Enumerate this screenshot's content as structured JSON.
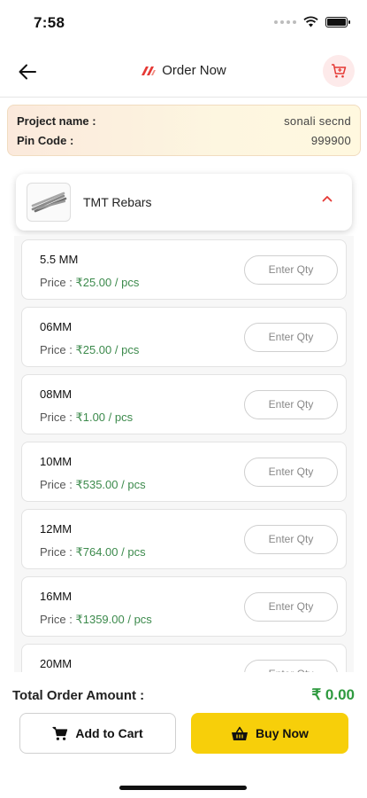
{
  "status_bar": {
    "time": "7:58"
  },
  "header": {
    "title": "Order Now"
  },
  "project": {
    "name_label": "Project name :",
    "name_value": "sonali secnd",
    "pin_label": "Pin Code :",
    "pin_value": "999900"
  },
  "product": {
    "name": "TMT Rebars"
  },
  "price_prefix": "Price : ",
  "items": [
    {
      "size": "5.5 MM",
      "price": "₹25.00 / pcs",
      "qty_placeholder": "Enter Qty"
    },
    {
      "size": "06MM",
      "price": "₹25.00 / pcs",
      "qty_placeholder": "Enter Qty"
    },
    {
      "size": "08MM",
      "price": "₹1.00 / pcs",
      "qty_placeholder": "Enter Qty"
    },
    {
      "size": "10MM",
      "price": "₹535.00 / pcs",
      "qty_placeholder": "Enter Qty"
    },
    {
      "size": "12MM",
      "price": "₹764.00 / pcs",
      "qty_placeholder": "Enter Qty"
    },
    {
      "size": "16MM",
      "price": "₹1359.00 / pcs",
      "qty_placeholder": "Enter Qty"
    },
    {
      "size": "20MM",
      "price": "",
      "qty_placeholder": "Enter Qty"
    }
  ],
  "footer": {
    "total_label": "Total Order Amount :",
    "total_value": "₹ 0.00",
    "add_to_cart": "Add to Cart",
    "buy_now": "Buy Now"
  },
  "colors": {
    "accent": "#f7cf0a",
    "price_green": "#3c8a4c",
    "total_green": "#2e9a3f",
    "brand_red": "#e53935"
  }
}
